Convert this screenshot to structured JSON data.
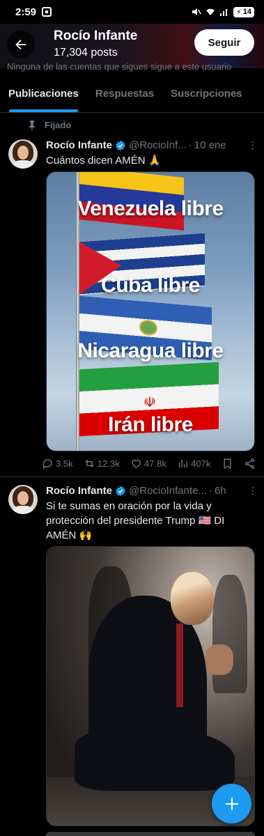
{
  "status_bar": {
    "time": "2:59",
    "battery": "14"
  },
  "header": {
    "title": "Rocío Infante",
    "posts_count": "17,304 posts",
    "follow_label": "Seguir",
    "follow_note": "Ninguna de las cuentas que sigues sigue a este usuario"
  },
  "tabs": [
    {
      "label": "Publicaciones",
      "active": true
    },
    {
      "label": "Respuestas",
      "active": false
    },
    {
      "label": "Suscripciones",
      "active": false
    }
  ],
  "pinned_label": "Fijado",
  "posts": [
    {
      "name": "Rocío Infante",
      "handle": "@RocioInf...",
      "time": "10 ene",
      "text": "Cuántos dicen AMÉN 🙏",
      "image_lines": [
        "Venezuela libre",
        "Cuba libre",
        "Nicaragua libre",
        "Irán libre"
      ],
      "stats": {
        "replies": "3.5k",
        "reposts": "12.3k",
        "likes": "47.8k",
        "views": "407k"
      }
    },
    {
      "name": "Rocío Infante",
      "handle": "@RocioInfante...",
      "time": "6h",
      "text": "Si te sumas en oración por la vida y protección del presidente Trump 🇺🇸 DI AMÉN 🙌"
    }
  ],
  "colors": {
    "accent": "#1d9bf0",
    "background": "#000000",
    "muted": "#71767b"
  },
  "icons": [
    "back-arrow-icon",
    "pin-icon",
    "verified-badge-icon",
    "more-icon",
    "reply-icon",
    "repost-icon",
    "like-icon",
    "views-icon",
    "bookmark-icon",
    "share-icon",
    "plus-icon"
  ]
}
